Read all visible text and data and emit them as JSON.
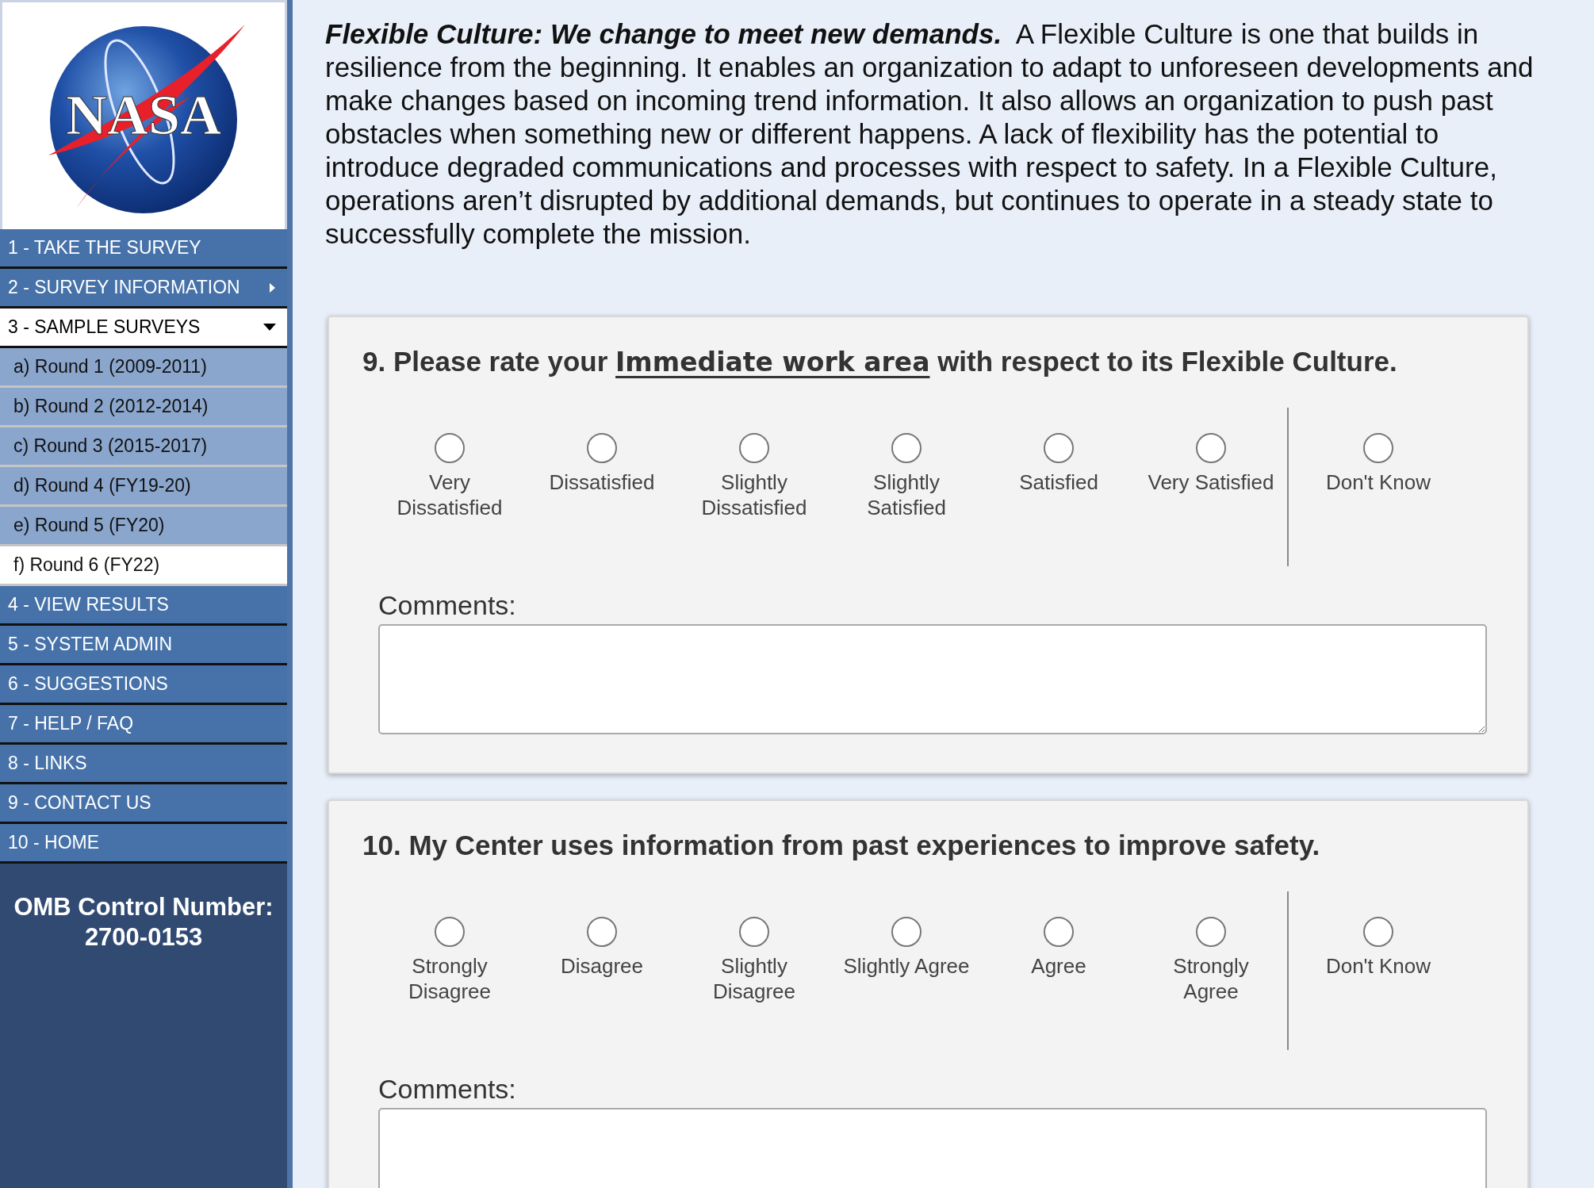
{
  "logo": {
    "text": "NASA"
  },
  "sidebar": {
    "items": [
      {
        "label": "1 - TAKE THE SURVEY",
        "kind": "link"
      },
      {
        "label": "2 - SURVEY INFORMATION",
        "kind": "submenu",
        "expanded": false
      },
      {
        "label": "3 - SAMPLE SURVEYS",
        "kind": "submenu",
        "expanded": true,
        "children": [
          {
            "label": "a) Round 1 (2009-2011)",
            "selected": false
          },
          {
            "label": "b) Round 2 (2012-2014)",
            "selected": false
          },
          {
            "label": "c) Round 3 (2015-2017)",
            "selected": false
          },
          {
            "label": "d) Round 4 (FY19-20)",
            "selected": false
          },
          {
            "label": "e) Round 5 (FY20)",
            "selected": false
          },
          {
            "label": "f) Round 6 (FY22)",
            "selected": true
          }
        ]
      },
      {
        "label": "4 - VIEW RESULTS",
        "kind": "link"
      },
      {
        "label": "5 - SYSTEM ADMIN",
        "kind": "link"
      },
      {
        "label": "6 - SUGGESTIONS",
        "kind": "link"
      },
      {
        "label": "7 - HELP / FAQ",
        "kind": "link"
      },
      {
        "label": "8 - LINKS",
        "kind": "link"
      },
      {
        "label": "9 - CONTACT US",
        "kind": "link"
      },
      {
        "label": "10 - HOME",
        "kind": "link"
      }
    ],
    "omb": {
      "label": "OMB Control Number:",
      "number": "2700-0153"
    }
  },
  "intro": {
    "lead": "Flexible Culture: We change to meet new demands.",
    "text": "A Flexible Culture is one that builds in resilience from the beginning. It enables an organization to adapt to unforeseen developments and make changes based on incoming trend information. It also allows an organization to push past obstacles when something new or different happens. A lack of flexibility has the potential to introduce degraded communications and processes with respect to safety. In a Flexible Culture, operations aren’t disrupted by additional demands, but continues to operate in a steady state to successfully complete the mission."
  },
  "questions": [
    {
      "title": "9. Please rate your **Immediate work area** with respect to its Flexible Culture.",
      "options": [
        {
          "label": "Very Dissatisfied",
          "kind": "scale",
          "selected": false
        },
        {
          "label": "Dissatisfied",
          "kind": "scale",
          "selected": false
        },
        {
          "label": "Slightly Dissatisfied",
          "kind": "scale",
          "selected": false
        },
        {
          "label": "Slightly Satisfied",
          "kind": "scale",
          "selected": false
        },
        {
          "label": "Satisfied",
          "kind": "scale",
          "selected": false
        },
        {
          "label": "Very Satisfied",
          "kind": "scale",
          "selected": false
        },
        {
          "label": "Don't Know",
          "kind": "dont-know",
          "selected": false
        }
      ],
      "comments_label": "Comments:"
    },
    {
      "title": "10. My Center uses information from past experiences to improve safety.",
      "options": [
        {
          "label": "Strongly Disagree",
          "kind": "scale",
          "selected": false
        },
        {
          "label": "Disagree",
          "kind": "scale",
          "selected": false
        },
        {
          "label": "Slightly Disagree",
          "kind": "scale",
          "selected": false
        },
        {
          "label": "Slightly Agree",
          "kind": "scale",
          "selected": false
        },
        {
          "label": "Agree",
          "kind": "scale",
          "selected": false
        },
        {
          "label": "Strongly Agree",
          "kind": "scale",
          "selected": false
        },
        {
          "label": "Don't Know",
          "kind": "dont-know",
          "selected": false
        }
      ],
      "comments_label": "Comments:"
    }
  ]
}
